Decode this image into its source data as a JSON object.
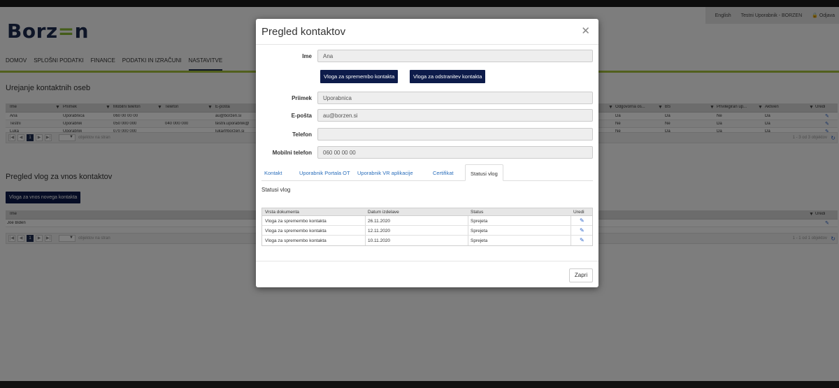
{
  "header": {
    "language": "English",
    "user": "Testni Uporabnik - BORZEN",
    "logout": "Odjava",
    "logo": "Borzen"
  },
  "nav": [
    "DOMOV",
    "SPLOŠNI PODATKI",
    "FINANCE",
    "PODATKI IN IZRAČUNI",
    "NASTAVITVE"
  ],
  "contacts": {
    "title": "Urejanje kontaktnih oseb",
    "headers_left": [
      "Ime",
      "Priimek",
      "Mobilni telefon",
      "Telefon",
      "E-pošta"
    ],
    "headers_right": [
      "Odgovorna os...",
      "BS",
      "Privilegiran up...",
      "Aktiven",
      "Uredi"
    ],
    "rows": [
      {
        "left": [
          "Ana",
          "Uporabnica",
          "060 00 00 00",
          "",
          "au@borzen.si"
        ],
        "right": [
          "Da",
          "Da",
          "Ne",
          "Da"
        ]
      },
      {
        "left": [
          "Testni",
          "Uporabnik",
          "050 000 000",
          "040 000 000",
          "testni.uporabnik@"
        ],
        "right": [
          "Ne",
          "Ne",
          "Da",
          "Da"
        ]
      },
      {
        "left": [
          "Luka",
          "Uporabnik",
          "070 000 000",
          "",
          "luka@borzen.si"
        ],
        "right": [
          "Ne",
          "Da",
          "Da",
          "Da"
        ]
      }
    ],
    "pager_label": "objektov na stran",
    "pager_page": "1",
    "pager_summary": "1 - 3 od 3 objektov"
  },
  "requests": {
    "title": "Pregled vlog za vnos kontaktov",
    "new_button": "Vloga za vnos novega kontakta",
    "headers": [
      "Ime",
      "Uredi"
    ],
    "rows": [
      [
        "Joe Biden"
      ]
    ],
    "pager_label": "objektov na stran",
    "pager_page": "1",
    "pager_summary": "1 - 1 od 1 objektov"
  },
  "modal": {
    "title": "Pregled kontaktov",
    "fields": {
      "ime_label": "Ime",
      "ime_value": "Ana",
      "priimek_label": "Priimek",
      "priimek_value": "Uporabnica",
      "eposta_label": "E-pošta",
      "eposta_value": "au@borzen.si",
      "telefon_label": "Telefon",
      "telefon_value": "",
      "mobilni_label": "Mobilni telefon",
      "mobilni_value": "060 00 00 00"
    },
    "btn_change": "Vloga za spremembo kontakta",
    "btn_remove": "Vloga za odstranitev kontakta",
    "tabs": [
      "Kontakt",
      "Uporabnik Portala OT",
      "Uporabnik VR aplikacije",
      "Certifikat",
      "Statusi vlog"
    ],
    "active_tab": "Statusi vlog",
    "section_title": "Statusi vlog",
    "table_headers": [
      "Vrsta dokumenta",
      "Datum izdelave",
      "Status",
      "Uredi"
    ],
    "table_rows": [
      [
        "Vloga za spremembo kontakta",
        "26.11.2020",
        "Sprejeta"
      ],
      [
        "Vloga za spremembo kontakta",
        "12.11.2020",
        "Sprejeta"
      ],
      [
        "Vloga za spremembo kontakta",
        "10.11.2020",
        "Sprejeta"
      ]
    ],
    "close_button": "Zapri"
  },
  "icons": {
    "close": "close-icon",
    "edit": "pencil-icon",
    "filter": "filter-icon",
    "refresh": "refresh-icon",
    "lock": "lock-icon"
  },
  "colors": {
    "primary_dark": "#0d1b4a",
    "accent_green": "#a4c13a",
    "link_blue": "#2a6ebb",
    "logo_navy": "#1d2b4f"
  }
}
